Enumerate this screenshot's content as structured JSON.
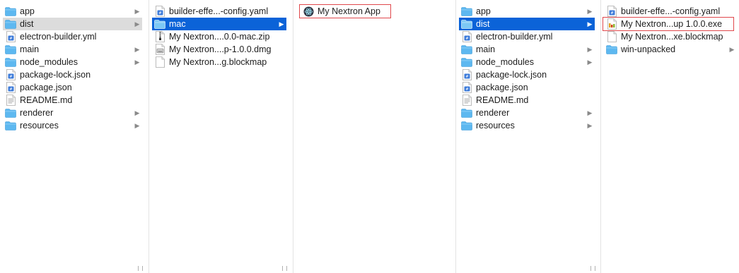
{
  "left_window": {
    "col1": {
      "items": [
        {
          "label": "app",
          "icon": "folder-icon",
          "chevron": "▶"
        },
        {
          "label": "dist",
          "icon": "folder-icon",
          "chevron": "▶"
        },
        {
          "label": "electron-builder.yml",
          "icon": "yaml-file-icon",
          "chevron": ""
        },
        {
          "label": "main",
          "icon": "folder-icon",
          "chevron": "▶"
        },
        {
          "label": "node_modules",
          "icon": "folder-icon",
          "chevron": "▶"
        },
        {
          "label": "package-lock.json",
          "icon": "json-file-icon",
          "chevron": ""
        },
        {
          "label": "package.json",
          "icon": "json-file-icon",
          "chevron": ""
        },
        {
          "label": "README.md",
          "icon": "text-file-icon",
          "chevron": ""
        },
        {
          "label": "renderer",
          "icon": "folder-icon",
          "chevron": "▶"
        },
        {
          "label": "resources",
          "icon": "folder-icon",
          "chevron": "▶"
        }
      ]
    },
    "col2": {
      "items": [
        {
          "label": "builder-effe...-config.yaml",
          "icon": "yaml-file-icon",
          "chevron": ""
        },
        {
          "label": "mac",
          "icon": "folder-icon",
          "chevron": "▶"
        },
        {
          "label": "My Nextron....0.0-mac.zip",
          "icon": "zip-file-icon",
          "chevron": ""
        },
        {
          "label": "My Nextron....p-1.0.0.dmg",
          "icon": "dmg-file-icon",
          "chevron": ""
        },
        {
          "label": "My Nextron...g.blockmap",
          "icon": "blank-file-icon",
          "chevron": ""
        }
      ]
    },
    "col3": {
      "items": [
        {
          "label": "My Nextron App",
          "icon": "electron-app-icon",
          "chevron": ""
        }
      ]
    }
  },
  "right_window": {
    "col1": {
      "items": [
        {
          "label": "app",
          "icon": "folder-icon",
          "chevron": "▶"
        },
        {
          "label": "dist",
          "icon": "folder-icon",
          "chevron": "▶"
        },
        {
          "label": "electron-builder.yml",
          "icon": "yaml-file-icon",
          "chevron": ""
        },
        {
          "label": "main",
          "icon": "folder-icon",
          "chevron": "▶"
        },
        {
          "label": "node_modules",
          "icon": "folder-icon",
          "chevron": "▶"
        },
        {
          "label": "package-lock.json",
          "icon": "json-file-icon",
          "chevron": ""
        },
        {
          "label": "package.json",
          "icon": "json-file-icon",
          "chevron": ""
        },
        {
          "label": "README.md",
          "icon": "text-file-icon",
          "chevron": ""
        },
        {
          "label": "renderer",
          "icon": "folder-icon",
          "chevron": "▶"
        },
        {
          "label": "resources",
          "icon": "folder-icon",
          "chevron": "▶"
        }
      ]
    },
    "col2": {
      "items": [
        {
          "label": "builder-effe...-config.yaml",
          "icon": "yaml-file-icon",
          "chevron": ""
        },
        {
          "label": "My Nextron...up 1.0.0.exe",
          "icon": "exe-file-icon",
          "chevron": ""
        },
        {
          "label": "My Nextron...xe.blockmap",
          "icon": "blank-file-icon",
          "chevron": ""
        },
        {
          "label": "win-unpacked",
          "icon": "folder-icon",
          "chevron": "▶"
        }
      ]
    }
  },
  "colors": {
    "selection_blue": "#0b63d8",
    "selection_gray": "#dcdcdc",
    "folder_blue": "#5db8f0",
    "highlight_red": "#e0484c"
  }
}
